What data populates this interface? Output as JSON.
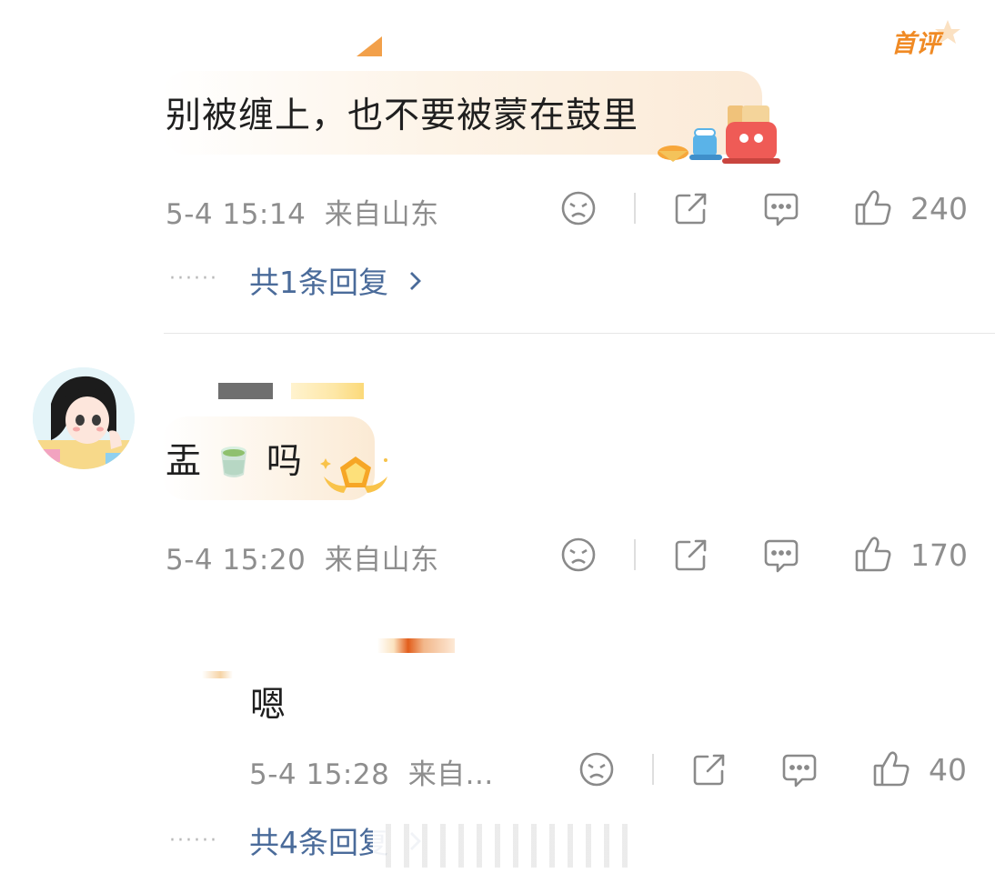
{
  "badge": {
    "label": "首评",
    "color": "#f08a24"
  },
  "comments": [
    {
      "text": "别被缠上，也不要被蒙在鼓里",
      "time": "5-4 15:14",
      "location": "来自山东",
      "likes": "240",
      "replies_link": "共1条回复"
    },
    {
      "text_before": "盂",
      "text_after": "吗",
      "emoji": "tea-cup-emoji",
      "time": "5-4 15:20",
      "location": "来自山东",
      "likes": "170"
    },
    {
      "text": "嗯",
      "time": "5-4 15:28",
      "location": "来自...",
      "likes": "40",
      "replies_link": "共4条回复"
    }
  ],
  "icons": [
    "sad-face-icon",
    "share-icon",
    "comment-icon",
    "thumbs-up-icon",
    "chevron-right-icon"
  ],
  "colors": {
    "meta": "#8e8e8e",
    "link": "#4a6b9a",
    "badge": "#f08a24"
  }
}
